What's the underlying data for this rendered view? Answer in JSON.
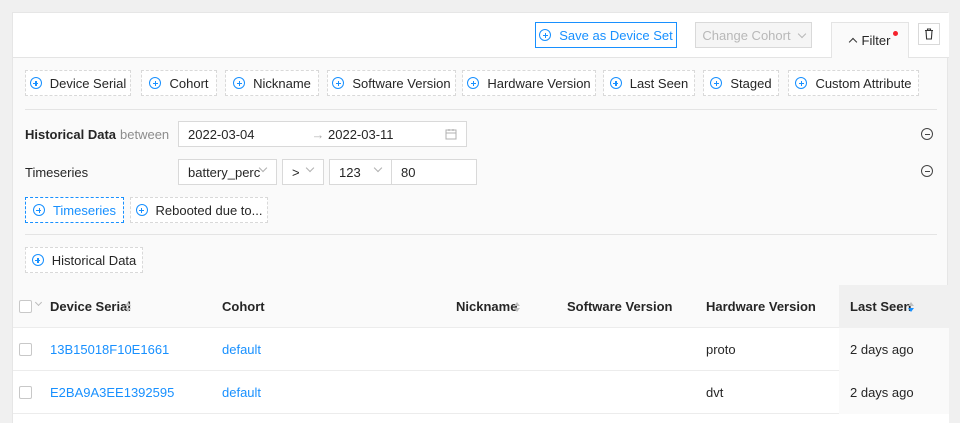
{
  "toolbar": {
    "save_as_device_set": "Save as Device Set",
    "change_cohort": "Change Cohort",
    "filter_tab": "Filter"
  },
  "filter_chips": [
    {
      "label": "Device Serial"
    },
    {
      "label": "Cohort"
    },
    {
      "label": "Nickname"
    },
    {
      "label": "Software Version"
    },
    {
      "label": "Hardware Version"
    },
    {
      "label": "Last Seen"
    },
    {
      "label": "Staged"
    },
    {
      "label": "Custom Attribute"
    }
  ],
  "historical": {
    "label": "Historical Data",
    "between": "between",
    "start_date": "2022-03-04",
    "arrow": "→",
    "end_date": "2022-03-11"
  },
  "timeseries": {
    "label": "Timeseries",
    "metric": "battery_perc",
    "operator": ">",
    "aggregate": "123",
    "value": "80"
  },
  "add_buttons": {
    "timeseries": "Timeseries",
    "rebooted": "Rebooted due to...",
    "historical": "Historical Data"
  },
  "table": {
    "headers": {
      "device_serial": "Device Serial",
      "cohort": "Cohort",
      "nickname": "Nickname",
      "software_version": "Software Version",
      "hardware_version": "Hardware Version",
      "last_seen": "Last Seen"
    },
    "rows": [
      {
        "device_serial": "13B15018F10E1661",
        "cohort": "default",
        "nickname": "",
        "software_version": "",
        "hardware_version": "proto",
        "last_seen": "2 days ago"
      },
      {
        "device_serial": "E2BA9A3EE1392595",
        "cohort": "default",
        "nickname": "",
        "software_version": "",
        "hardware_version": "dvt",
        "last_seen": "2 days ago"
      }
    ]
  },
  "colors": {
    "accent": "#1890ff",
    "badge": "#f5222d"
  }
}
